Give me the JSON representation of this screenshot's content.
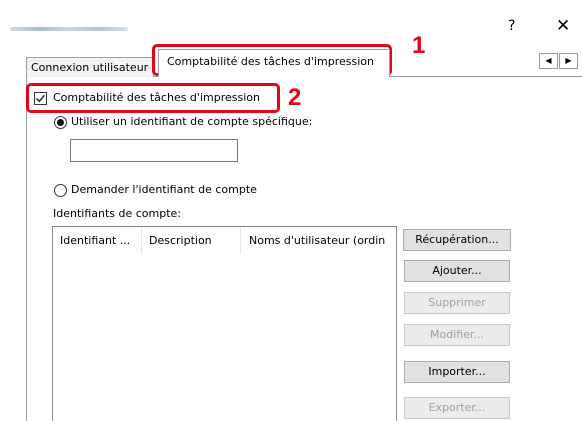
{
  "window": {
    "help_label": "?",
    "close_label": "✕"
  },
  "tabs": [
    {
      "label": "Connexion utilisateur"
    },
    {
      "label": "Comptabilité des tâches d'impression"
    }
  ],
  "tab_scroll": {
    "left": "◀",
    "right": "▶"
  },
  "callouts": [
    "1",
    "2"
  ],
  "accounting_checkbox": {
    "label": "Comptabilité des tâches d'impression",
    "checked": true
  },
  "radio_specific": {
    "label": "Utiliser un identifiant de compte spécifique:",
    "selected": true
  },
  "account_id_input": {
    "value": ""
  },
  "radio_ask": {
    "label": "Demander l'identifiant de compte",
    "selected": false
  },
  "account_ids_label": "Identifiants de compte:",
  "list_columns": [
    "Identifiant ...",
    "Description",
    "Noms d'utilisateur (ordin"
  ],
  "buttons": {
    "recuperation": "Récupération...",
    "ajouter": "Ajouter...",
    "supprimer": "Supprimer",
    "modifier": "Modifier...",
    "importer": "Importer...",
    "exporter": "Exporter..."
  },
  "colors": {
    "callout": "#e3061a"
  }
}
